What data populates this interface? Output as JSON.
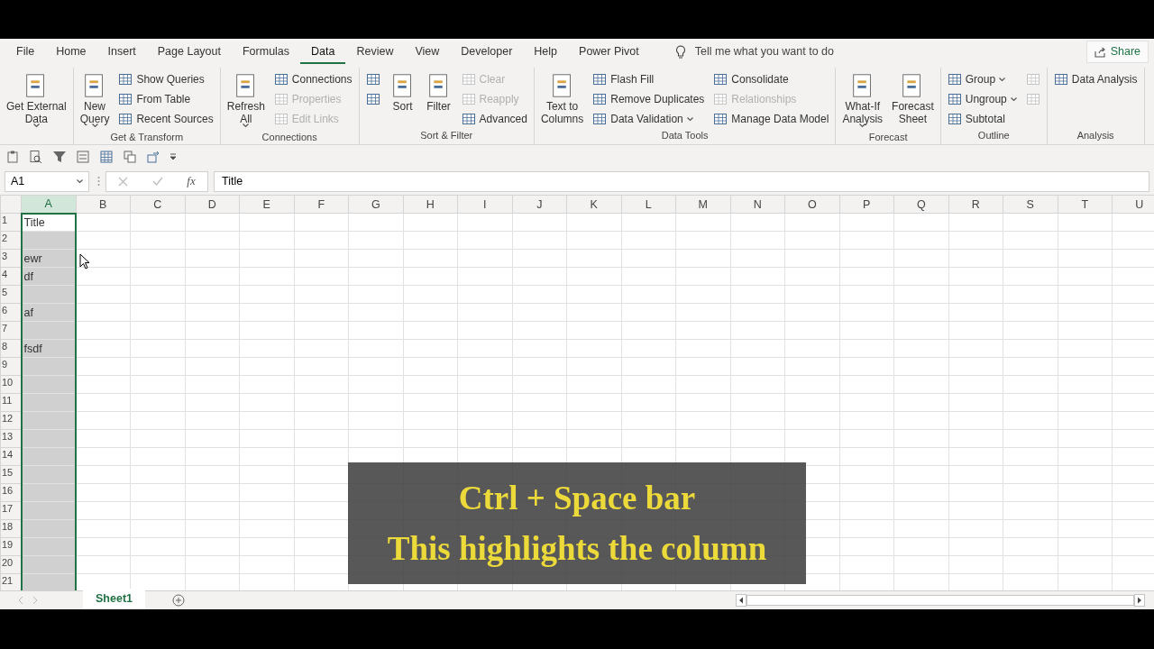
{
  "menu_tabs": [
    {
      "label": "File",
      "selected": false
    },
    {
      "label": "Home",
      "selected": false
    },
    {
      "label": "Insert",
      "selected": false
    },
    {
      "label": "Page Layout",
      "selected": false
    },
    {
      "label": "Formulas",
      "selected": false
    },
    {
      "label": "Data",
      "selected": true
    },
    {
      "label": "Review",
      "selected": false
    },
    {
      "label": "View",
      "selected": false
    },
    {
      "label": "Developer",
      "selected": false
    },
    {
      "label": "Help",
      "selected": false
    },
    {
      "label": "Power Pivot",
      "selected": false
    }
  ],
  "tell_me": {
    "placeholder": "Tell me what you want to do"
  },
  "share": "Share",
  "ribbon_groups": [
    {
      "columns": [
        {
          "kind": "large",
          "items": [
            {
              "label": "Get External\nData",
              "dropdown": true,
              "disabled": false
            }
          ]
        }
      ]
    },
    {
      "label": "Get & Transform",
      "columns": [
        {
          "kind": "large",
          "items": [
            {
              "label": "New\nQuery",
              "dropdown": true,
              "disabled": false
            }
          ]
        },
        {
          "kind": "stack",
          "items": [
            {
              "label": "Show Queries",
              "dropdown": false,
              "disabled": false
            },
            {
              "label": "From Table",
              "dropdown": false,
              "disabled": false
            },
            {
              "label": "Recent Sources",
              "dropdown": false,
              "disabled": false
            }
          ]
        }
      ]
    },
    {
      "label": "Connections",
      "columns": [
        {
          "kind": "large",
          "items": [
            {
              "label": "Refresh\nAll",
              "dropdown": true,
              "disabled": false
            }
          ]
        },
        {
          "kind": "stack",
          "items": [
            {
              "label": "Connections",
              "dropdown": false,
              "disabled": false
            },
            {
              "label": "Properties",
              "dropdown": false,
              "disabled": true
            },
            {
              "label": "Edit Links",
              "dropdown": false,
              "disabled": true
            }
          ]
        }
      ]
    },
    {
      "label": "Sort & Filter",
      "columns": [
        {
          "kind": "stack",
          "items": [
            {
              "dropdown": false,
              "disabled": false
            },
            {
              "dropdown": false,
              "disabled": false
            }
          ]
        },
        {
          "kind": "large",
          "items": [
            {
              "label": "Sort",
              "dropdown": false,
              "disabled": false
            }
          ]
        },
        {
          "kind": "large",
          "items": [
            {
              "label": "Filter",
              "dropdown": false,
              "disabled": false
            }
          ]
        },
        {
          "kind": "stack",
          "items": [
            {
              "label": "Clear",
              "dropdown": false,
              "disabled": true
            },
            {
              "label": "Reapply",
              "dropdown": false,
              "disabled": true
            },
            {
              "label": "Advanced",
              "dropdown": false,
              "disabled": false
            }
          ]
        }
      ]
    },
    {
      "label": "Data Tools",
      "columns": [
        {
          "kind": "large",
          "items": [
            {
              "label": "Text to\nColumns",
              "dropdown": false,
              "disabled": false
            }
          ]
        },
        {
          "kind": "stack",
          "items": [
            {
              "label": "Flash Fill",
              "dropdown": false,
              "disabled": false
            },
            {
              "label": "Remove Duplicates",
              "dropdown": false,
              "disabled": false
            },
            {
              "label": "Data Validation",
              "dropdown": true,
              "disabled": false
            }
          ]
        },
        {
          "kind": "stack",
          "items": [
            {
              "label": "Consolidate",
              "dropdown": false,
              "disabled": false
            },
            {
              "label": "Relationships",
              "dropdown": false,
              "disabled": true
            },
            {
              "label": "Manage Data Model",
              "dropdown": false,
              "disabled": false
            }
          ]
        }
      ]
    },
    {
      "label": "Forecast",
      "columns": [
        {
          "kind": "large",
          "items": [
            {
              "label": "What-If\nAnalysis",
              "dropdown": true,
              "disabled": false
            }
          ]
        },
        {
          "kind": "large",
          "items": [
            {
              "label": "Forecast\nSheet",
              "dropdown": false,
              "disabled": false
            }
          ]
        }
      ]
    },
    {
      "label": "Outline",
      "columns": [
        {
          "kind": "stack",
          "items": [
            {
              "label": "Group",
              "dropdown": true,
              "disabled": false
            },
            {
              "label": "Ungroup",
              "dropdown": true,
              "disabled": false
            },
            {
              "label": "Subtotal",
              "dropdown": false,
              "disabled": false
            }
          ]
        },
        {
          "kind": "stack",
          "items": [
            {
              "dropdown": false,
              "disabled": true
            },
            {
              "dropdown": false,
              "disabled": true
            }
          ]
        }
      ]
    },
    {
      "label": "Analysis",
      "columns": [
        {
          "kind": "stack",
          "items": [
            {
              "label": "Data Analysis",
              "dropdown": false,
              "disabled": false
            }
          ]
        }
      ]
    }
  ],
  "formula_bar": {
    "name_box": "A1",
    "function_label": "fx",
    "value": "Title"
  },
  "columns": [
    {
      "label": "A",
      "selected": true
    },
    {
      "label": "B",
      "selected": false
    },
    {
      "label": "C",
      "selected": false
    },
    {
      "label": "D",
      "selected": false
    },
    {
      "label": "E",
      "selected": false
    },
    {
      "label": "F",
      "selected": false
    },
    {
      "label": "G",
      "selected": false
    },
    {
      "label": "H",
      "selected": false
    },
    {
      "label": "I",
      "selected": false
    },
    {
      "label": "J",
      "selected": false
    },
    {
      "label": "K",
      "selected": false
    },
    {
      "label": "L",
      "selected": false
    },
    {
      "label": "M",
      "selected": false
    },
    {
      "label": "N",
      "selected": false
    },
    {
      "label": "O",
      "selected": false
    },
    {
      "label": "P",
      "selected": false
    },
    {
      "label": "Q",
      "selected": false
    },
    {
      "label": "R",
      "selected": false
    },
    {
      "label": "S",
      "selected": false
    },
    {
      "label": "T",
      "selected": false
    },
    {
      "label": "U",
      "selected": false
    }
  ],
  "rows": [
    {
      "label": "1",
      "cell_a": "Title"
    },
    {
      "label": "2"
    },
    {
      "label": "3",
      "cell_a": "ewr"
    },
    {
      "label": "4",
      "cell_a": "df"
    },
    {
      "label": "5"
    },
    {
      "label": "6",
      "cell_a": "af"
    },
    {
      "label": "7"
    },
    {
      "label": "8",
      "cell_a": "fsdf"
    },
    {
      "label": "9"
    },
    {
      "label": "10"
    },
    {
      "label": "11"
    },
    {
      "label": "12"
    },
    {
      "label": "13"
    },
    {
      "label": "14"
    },
    {
      "label": "15"
    },
    {
      "label": "16"
    },
    {
      "label": "17"
    },
    {
      "label": "18"
    },
    {
      "label": "19"
    },
    {
      "label": "20"
    },
    {
      "label": "21"
    }
  ],
  "caption": [
    "Ctrl + Space bar",
    "This highlights the column"
  ],
  "sheet_tabs": [
    {
      "label": "Sheet1",
      "selected": true
    }
  ]
}
